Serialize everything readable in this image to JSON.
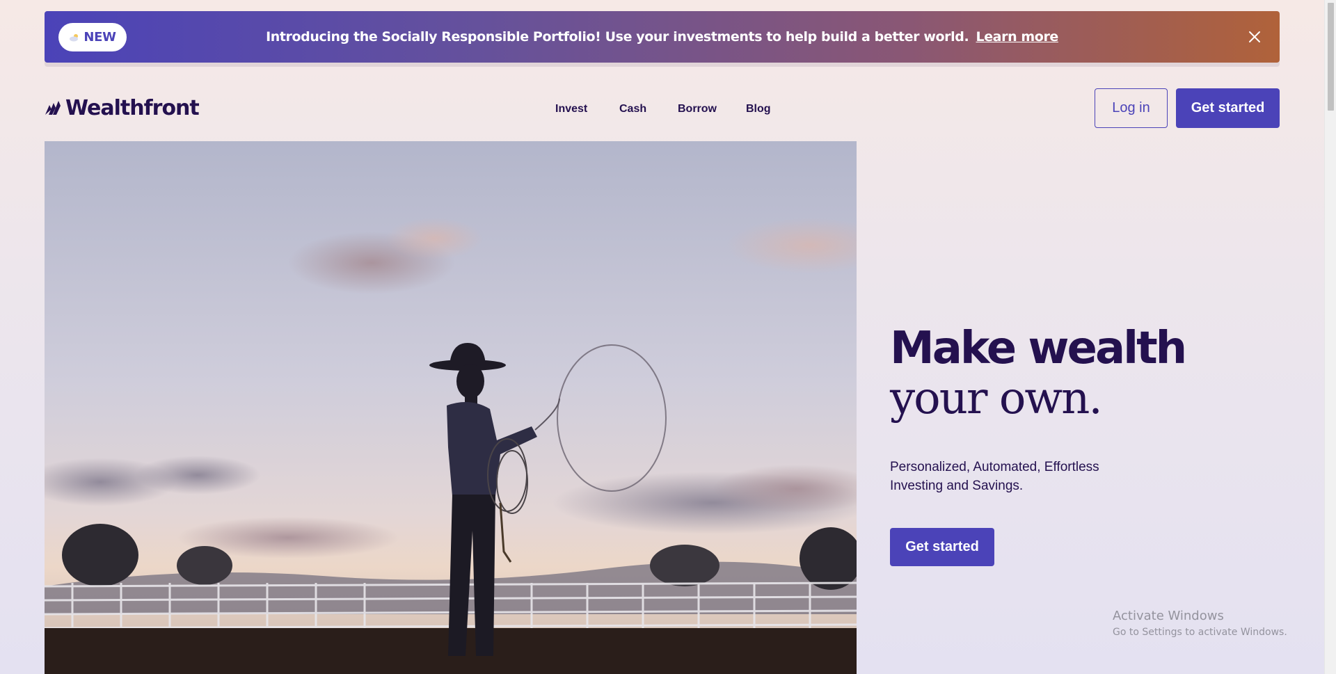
{
  "banner": {
    "badge_label": "NEW",
    "badge_icon": "cloud-sun-icon",
    "text": "Introducing the Socially Responsible Portfolio! Use your investments to help build a better world.",
    "link_label": "Learn more",
    "close_icon": "close-icon"
  },
  "header": {
    "logo_text": "Wealthfront",
    "nav": [
      "Invest",
      "Cash",
      "Borrow",
      "Blog"
    ],
    "login_label": "Log in",
    "get_started_label": "Get started"
  },
  "hero": {
    "headline_line1": "Make wealth",
    "headline_line2": "your own.",
    "subtitle": "Personalized, Automated, Effortless Investing and Savings.",
    "cta_label": "Get started"
  },
  "watermark": {
    "title": "Activate Windows",
    "subtitle": "Go to Settings to activate Windows."
  },
  "colors": {
    "brand": "#4b43b8",
    "text_dark": "#24114f"
  }
}
